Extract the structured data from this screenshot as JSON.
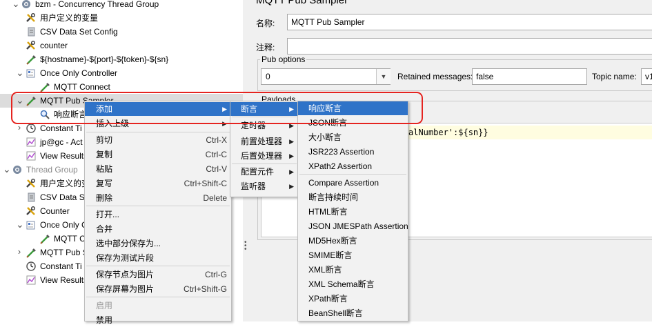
{
  "tree": {
    "items": [
      {
        "label": "bzm - Concurrency Thread Group",
        "icon": "gear-icon",
        "chevron": "expanded",
        "disabled": false
      },
      {
        "label": "用户定义的变量",
        "icon": "wrench-icon"
      },
      {
        "label": "CSV Data Set Config",
        "icon": "document-icon"
      },
      {
        "label": "counter",
        "icon": "wrench-icon"
      },
      {
        "label": "${hostname}-${port}-${token}-${sn}",
        "icon": "pipette-icon"
      },
      {
        "label": "Once Only Controller",
        "icon": "controller-icon",
        "chevron": "expanded"
      },
      {
        "label": "MQTT Connect",
        "icon": "pipette-icon"
      },
      {
        "label": "MQTT Pub Sampler",
        "icon": "pipette-icon",
        "chevron": "expanded"
      },
      {
        "label": "响应断言",
        "icon": "magnifier-icon"
      },
      {
        "label": "Constant Ti",
        "icon": "timer-icon",
        "chevron": "collapsed"
      },
      {
        "label": "jp@gc - Act",
        "icon": "graph-icon"
      },
      {
        "label": "View Results",
        "icon": "graph-icon"
      },
      {
        "label": "Thread Group",
        "icon": "gear-icon",
        "chevron": "expanded",
        "disabled": true
      },
      {
        "label": "用户定义的变",
        "icon": "wrench-icon"
      },
      {
        "label": "CSV Data Set",
        "icon": "document-icon"
      },
      {
        "label": "Counter",
        "icon": "wrench-icon"
      },
      {
        "label": "Once Only C",
        "icon": "controller-icon",
        "chevron": "expanded"
      },
      {
        "label": "MQTT C",
        "icon": "pipette-icon"
      },
      {
        "label": "MQTT Pub S",
        "icon": "pipette-icon",
        "chevron": "collapsed"
      },
      {
        "label": "Constant Ti",
        "icon": "timer-icon"
      },
      {
        "label": "View Results",
        "icon": "graph-icon"
      }
    ]
  },
  "panel": {
    "title": "MQTT Pub Sampler",
    "name_label": "名称:",
    "name_value": "MQTT Pub Sampler",
    "comment_label": "注释:",
    "comment_value": "",
    "pub_options_title": "Pub options",
    "qos_value": "0",
    "retained_label": "Retained messages:",
    "retained_value": "false",
    "topic_label": "Topic name:",
    "topic_value": "v1",
    "payloads_title": "Payloads",
    "payload_snippet": "alNumber':${sn}}"
  },
  "context_menu": {
    "items": [
      {
        "label": "添加",
        "submenu": true,
        "highlight": true
      },
      {
        "label": "插入上级",
        "submenu": true
      },
      {
        "label": "剪切",
        "shortcut": "Ctrl-X"
      },
      {
        "label": "复制",
        "shortcut": "Ctrl-C"
      },
      {
        "label": "粘贴",
        "shortcut": "Ctrl-V"
      },
      {
        "label": "复写",
        "shortcut": "Ctrl+Shift-C"
      },
      {
        "label": "删除",
        "shortcut": "Delete"
      },
      {
        "label": "打开..."
      },
      {
        "label": "合并"
      },
      {
        "label": "选中部分保存为..."
      },
      {
        "label": "保存为测试片段"
      },
      {
        "label": "保存节点为图片",
        "shortcut": "Ctrl-G"
      },
      {
        "label": "保存屏幕为图片",
        "shortcut": "Ctrl+Shift-G"
      },
      {
        "label": "启用",
        "disabled": true
      },
      {
        "label": "禁用"
      }
    ]
  },
  "add_submenu": {
    "items": [
      {
        "label": "断言",
        "highlight": true
      },
      {
        "label": "定时器"
      },
      {
        "label": "前置处理器"
      },
      {
        "label": "后置处理器"
      },
      {
        "label": "配置元件"
      },
      {
        "label": "监听器"
      }
    ]
  },
  "assertion_submenu": {
    "items": [
      {
        "label": "响应断言",
        "highlight": true
      },
      {
        "label": "JSON断言"
      },
      {
        "label": "大小断言"
      },
      {
        "label": "JSR223 Assertion"
      },
      {
        "label": "XPath2 Assertion"
      },
      {
        "label": "Compare Assertion"
      },
      {
        "label": "断言持续时间"
      },
      {
        "label": "HTML断言"
      },
      {
        "label": "JSON JMESPath Assertion"
      },
      {
        "label": "MD5Hex断言"
      },
      {
        "label": "SMIME断言"
      },
      {
        "label": "XML断言"
      },
      {
        "label": "XML Schema断言"
      },
      {
        "label": "XPath断言"
      },
      {
        "label": "BeanShell断言"
      }
    ]
  },
  "colors": {
    "highlight": "#2f73c8",
    "annotation": "#e52420"
  }
}
